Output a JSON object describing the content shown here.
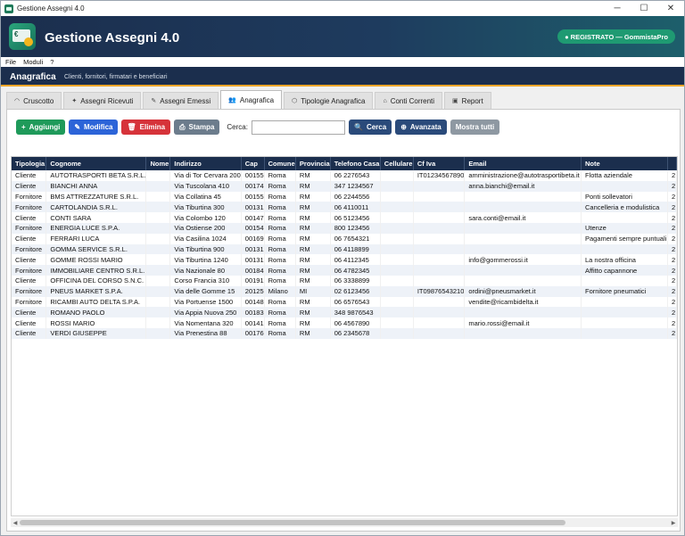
{
  "window": {
    "title": "Gestione Assegni 4.0"
  },
  "header": {
    "app_title": "Gestione Assegni 4.0",
    "registration_badge": "● REGISTRATO — GommistaPro",
    "logo_icon": "cheque-card-icon"
  },
  "menu": [
    "File",
    "Moduli",
    "?"
  ],
  "section": {
    "title": "Anagrafica",
    "subtitle": "Clienti, fornitori, firmatari e beneficiari"
  },
  "tabs": [
    {
      "label": "Cruscotto",
      "icon": "dashboard-icon",
      "glyph": "◠"
    },
    {
      "label": "Assegni Ricevuti",
      "icon": "inbox-icon",
      "glyph": "✦"
    },
    {
      "label": "Assegni Emessi",
      "icon": "send-icon",
      "glyph": "✎"
    },
    {
      "label": "Anagrafica",
      "icon": "people-icon",
      "glyph": "👥",
      "active": true
    },
    {
      "label": "Tipologie Anagrafica",
      "icon": "tag-icon",
      "glyph": "⬡"
    },
    {
      "label": "Conti Correnti",
      "icon": "bank-icon",
      "glyph": "⌂"
    },
    {
      "label": "Report",
      "icon": "report-icon",
      "glyph": "▣"
    }
  ],
  "toolbar": {
    "add": "Aggiungi",
    "edit": "Modifica",
    "delete": "Elimina",
    "print": "Stampa",
    "search_label": "Cerca:",
    "search_value": "",
    "search_button": "Cerca",
    "advanced": "Avanzata",
    "show_all": "Mostra tutti"
  },
  "table": {
    "columns": [
      "Tipologia",
      "Cognome",
      "Nome",
      "Indirizzo",
      "Cap",
      "Comune",
      "Provincia",
      "Telefono Casa",
      "Cellulare",
      "Cf Iva",
      "Email",
      "Note",
      ""
    ],
    "rows": [
      [
        "Cliente",
        "AUTOTRASPORTI BETA S.R.L.",
        "",
        "Via di Tor Cervara 200",
        "00155",
        "Roma",
        "RM",
        "06 2276543",
        "",
        "IT01234567890",
        "amministrazione@autotrasportibeta.it",
        "Flotta aziendale",
        "2"
      ],
      [
        "Cliente",
        "BIANCHI ANNA",
        "",
        "Via Tuscolana 410",
        "00174",
        "Roma",
        "RM",
        "347 1234567",
        "",
        "",
        "anna.bianchi@email.it",
        "",
        "2"
      ],
      [
        "Fornitore",
        "BMS ATTREZZATURE S.R.L.",
        "",
        "Via Collatina 45",
        "00155",
        "Roma",
        "RM",
        "06 2244556",
        "",
        "",
        "",
        "Ponti sollevatori",
        "2"
      ],
      [
        "Fornitore",
        "CARTOLANDIA S.R.L.",
        "",
        "Via Tiburtina 300",
        "00131",
        "Roma",
        "RM",
        "06 4110011",
        "",
        "",
        "",
        "Cancelleria e modulistica",
        "2"
      ],
      [
        "Cliente",
        "CONTI SARA",
        "",
        "Via Colombo 120",
        "00147",
        "Roma",
        "RM",
        "06 5123456",
        "",
        "",
        "sara.conti@email.it",
        "",
        "2"
      ],
      [
        "Fornitore",
        "ENERGIA LUCE S.P.A.",
        "",
        "Via Ostiense 200",
        "00154",
        "Roma",
        "RM",
        "800 123456",
        "",
        "",
        "",
        "Utenze",
        "2"
      ],
      [
        "Cliente",
        "FERRARI LUCA",
        "",
        "Via Casilina 1024",
        "00169",
        "Roma",
        "RM",
        "06 7654321",
        "",
        "",
        "",
        "Pagamenti sempre puntuali",
        "2"
      ],
      [
        "Fornitore",
        "GOMMA SERVICE S.R.L.",
        "",
        "Via Tiburtina 900",
        "00131",
        "Roma",
        "RM",
        "06 4118899",
        "",
        "",
        "",
        "",
        "2"
      ],
      [
        "Cliente",
        "GOMME ROSSI MARIO",
        "",
        "Via Tiburtina 1240",
        "00131",
        "Roma",
        "RM",
        "06 4112345",
        "",
        "",
        "info@gommerossi.it",
        "La nostra officina",
        "2"
      ],
      [
        "Fornitore",
        "IMMOBILIARE CENTRO S.R.L.",
        "",
        "Via Nazionale 80",
        "00184",
        "Roma",
        "RM",
        "06 4782345",
        "",
        "",
        "",
        "Affitto capannone",
        "2"
      ],
      [
        "Cliente",
        "OFFICINA DEL CORSO S.N.C.",
        "",
        "Corso Francia 310",
        "00191",
        "Roma",
        "RM",
        "06 3338899",
        "",
        "",
        "",
        "",
        "2"
      ],
      [
        "Fornitore",
        "PNEUS MARKET S.P.A.",
        "",
        "Via delle Gomme 15",
        "20125",
        "Milano",
        "MI",
        "02 6123456",
        "",
        "IT09876543210",
        "ordini@pneusmarket.it",
        "Fornitore pneumatici",
        "2"
      ],
      [
        "Fornitore",
        "RICAMBI AUTO DELTA S.P.A.",
        "",
        "Via Portuense 1500",
        "00148",
        "Roma",
        "RM",
        "06 6576543",
        "",
        "",
        "vendite@ricambidelta.it",
        "",
        "2"
      ],
      [
        "Cliente",
        "ROMANO PAOLO",
        "",
        "Via Appia Nuova 250",
        "00183",
        "Roma",
        "RM",
        "348 9876543",
        "",
        "",
        "",
        "",
        "2"
      ],
      [
        "Cliente",
        "ROSSI MARIO",
        "",
        "Via Nomentana 320",
        "00141",
        "Roma",
        "RM",
        "06 4567890",
        "",
        "",
        "mario.rossi@email.it",
        "",
        "2"
      ],
      [
        "Cliente",
        "VERDI GIUSEPPE",
        "",
        "Via Prenestina 88",
        "00176",
        "Roma",
        "RM",
        "06 2345678",
        "",
        "",
        "",
        "",
        "2"
      ]
    ]
  },
  "colors": {
    "header_dark": "#1b2e4d",
    "accent_orange": "#f0a528",
    "green": "#1f9a5a",
    "blue": "#2c64d8",
    "red": "#d6333a"
  }
}
